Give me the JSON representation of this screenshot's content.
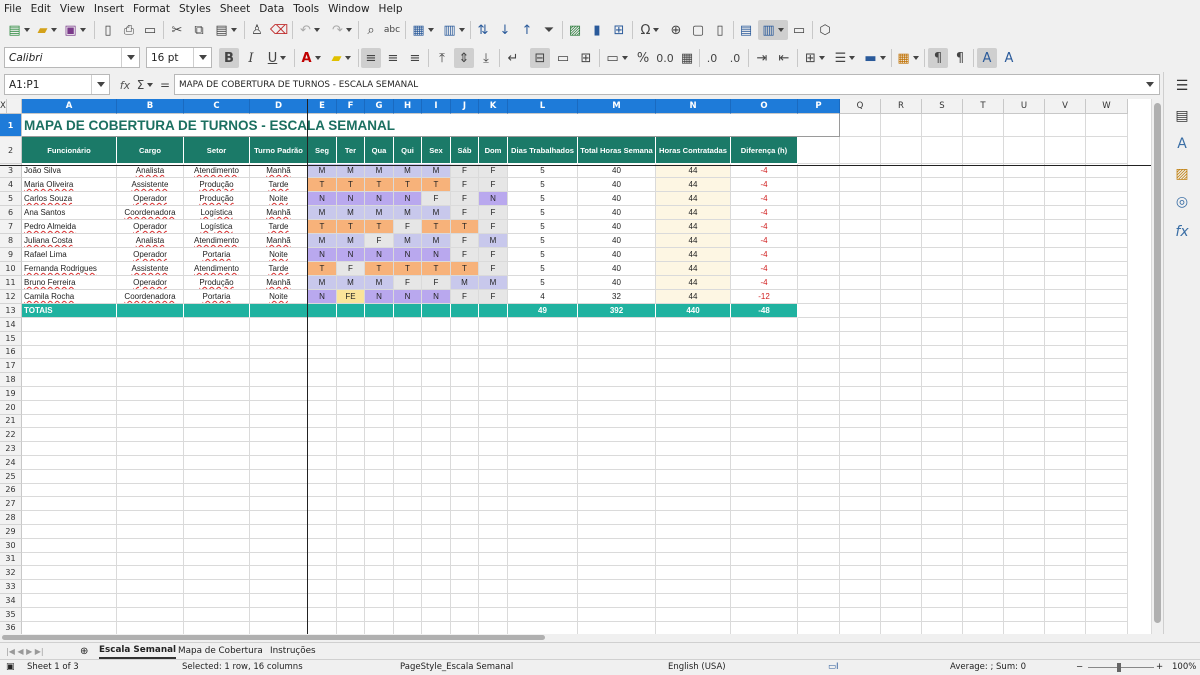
{
  "menu": [
    "File",
    "Edit",
    "View",
    "Insert",
    "Format",
    "Styles",
    "Sheet",
    "Data",
    "Tools",
    "Window",
    "Help"
  ],
  "toolbar": {
    "font_name": "Calibri",
    "font_size": "16 pt",
    "bold": "B",
    "italic": "I",
    "underline": "U"
  },
  "formula_bar": {
    "name_box": "A1:P1",
    "fx": "fx",
    "sigma": "Σ",
    "equals": "=",
    "content": "MAPA DE COBERTURA DE TURNOS - ESCALA SEMANAL"
  },
  "columns": [
    "A",
    "B",
    "C",
    "D",
    "E",
    "F",
    "G",
    "H",
    "I",
    "J",
    "K",
    "L",
    "M",
    "N",
    "O",
    "P",
    "Q",
    "R",
    "S",
    "T",
    "U",
    "V",
    "W",
    "X"
  ],
  "rows": [
    "1",
    "2",
    "3",
    "4",
    "5",
    "6",
    "7",
    "8",
    "9",
    "10",
    "11",
    "12",
    "13",
    "14",
    "15",
    "16",
    "17",
    "18",
    "19",
    "20",
    "21",
    "22",
    "23",
    "24",
    "25",
    "26",
    "27",
    "28",
    "29",
    "30",
    "31",
    "32",
    "33",
    "34",
    "35",
    "36"
  ],
  "sheet": {
    "title": "MAPA DE COBERTURA DE TURNOS - ESCALA SEMANAL",
    "headers": [
      "Funcionário",
      "Cargo",
      "Setor",
      "Turno Padrão",
      "Seg",
      "Ter",
      "Qua",
      "Qui",
      "Sex",
      "Sáb",
      "Dom",
      "Dias Trabalhados",
      "Total Horas Semana",
      "Horas Contratadas",
      "Diferença (h)"
    ],
    "employees": [
      {
        "name": "João Silva",
        "cargo": "Analista",
        "setor": "Atendimento",
        "turno": "Manhã",
        "days": [
          "M",
          "M",
          "M",
          "M",
          "M",
          "F",
          "F"
        ],
        "dias": "5",
        "total": "40",
        "contr": "44",
        "dif": "-4"
      },
      {
        "name": "Maria Oliveira",
        "cargo": "Assistente",
        "setor": "Produção",
        "turno": "Tarde",
        "days": [
          "T",
          "T",
          "T",
          "T",
          "T",
          "F",
          "F"
        ],
        "dias": "5",
        "total": "40",
        "contr": "44",
        "dif": "-4"
      },
      {
        "name": "Carlos Souza",
        "cargo": "Operador",
        "setor": "Produção",
        "turno": "Noite",
        "days": [
          "N",
          "N",
          "N",
          "N",
          "F",
          "F",
          "N"
        ],
        "dias": "5",
        "total": "40",
        "contr": "44",
        "dif": "-4"
      },
      {
        "name": "Ana Santos",
        "cargo": "Coordenadora",
        "setor": "Logística",
        "turno": "Manhã",
        "days": [
          "M",
          "M",
          "M",
          "M",
          "M",
          "F",
          "F"
        ],
        "dias": "5",
        "total": "40",
        "contr": "44",
        "dif": "-4"
      },
      {
        "name": "Pedro Almeida",
        "cargo": "Operador",
        "setor": "Logística",
        "turno": "Tarde",
        "days": [
          "T",
          "T",
          "T",
          "F",
          "T",
          "T",
          "F"
        ],
        "dias": "5",
        "total": "40",
        "contr": "44",
        "dif": "-4"
      },
      {
        "name": "Juliana Costa",
        "cargo": "Analista",
        "setor": "Atendimento",
        "turno": "Manhã",
        "days": [
          "M",
          "M",
          "F",
          "M",
          "M",
          "F",
          "M"
        ],
        "dias": "5",
        "total": "40",
        "contr": "44",
        "dif": "-4"
      },
      {
        "name": "Rafael Lima",
        "cargo": "Operador",
        "setor": "Portaria",
        "turno": "Noite",
        "days": [
          "N",
          "N",
          "N",
          "N",
          "N",
          "F",
          "F"
        ],
        "dias": "5",
        "total": "40",
        "contr": "44",
        "dif": "-4"
      },
      {
        "name": "Fernanda Rodrigues",
        "cargo": "Assistente",
        "setor": "Atendimento",
        "turno": "Tarde",
        "days": [
          "T",
          "F",
          "T",
          "T",
          "T",
          "T",
          "F"
        ],
        "dias": "5",
        "total": "40",
        "contr": "44",
        "dif": "-4"
      },
      {
        "name": "Bruno Ferreira",
        "cargo": "Operador",
        "setor": "Produção",
        "turno": "Manhã",
        "days": [
          "M",
          "M",
          "M",
          "F",
          "F",
          "M",
          "M"
        ],
        "dias": "5",
        "total": "40",
        "contr": "44",
        "dif": "-4"
      },
      {
        "name": "Camila Rocha",
        "cargo": "Coordenadora",
        "setor": "Portaria",
        "turno": "Noite",
        "days": [
          "N",
          "FE",
          "N",
          "N",
          "N",
          "F",
          "F"
        ],
        "dias": "4",
        "total": "32",
        "contr": "44",
        "dif": "-12"
      }
    ],
    "totals": {
      "label": "TOTAIS",
      "dias": "49",
      "total": "392",
      "contr": "440",
      "dif": "-48"
    }
  },
  "shift_colors": {
    "M": "#c8c8ec",
    "T": "#f7b27a",
    "N": "#b9a8ee",
    "F": "#e6e6e6",
    "FE": "#fbe49a"
  },
  "tabs": [
    "Escala Semanal",
    "Mapa de Cobertura",
    "Instruções"
  ],
  "status": {
    "sheet": "Sheet 1 of 3",
    "selection": "Selected: 1 row, 16 columns",
    "page_style": "PageStyle_Escala Semanal",
    "language": "English (USA)",
    "sum": "Average: ; Sum: 0",
    "zoom": "100%"
  }
}
